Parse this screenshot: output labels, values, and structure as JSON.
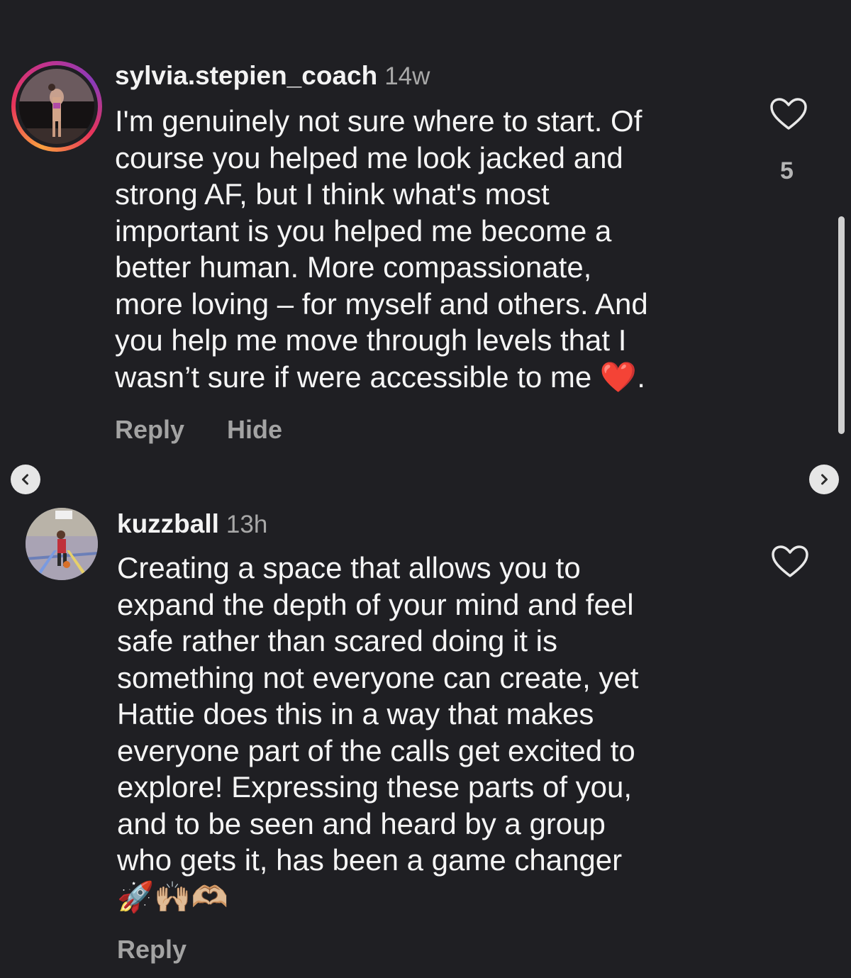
{
  "comments": [
    {
      "username": "sylvia.stepien_coach",
      "time": "14w",
      "lines": [
        "I'm genuinely not sure where to start. Of",
        "course you helped me look jacked and",
        "strong AF, but I think what's most",
        "important is you helped me become a",
        "better human. More compassionate,",
        "more loving – for myself and others. And",
        "you help me move through levels that I",
        "wasn’t sure if were accessible to me ❤️."
      ],
      "like_count": "5",
      "reply_label": "Reply",
      "hide_label": "Hide",
      "has_story_ring": true
    },
    {
      "username": "kuzzball",
      "time": "13h",
      "lines": [
        "Creating a space that allows you to",
        "expand the depth of your mind and feel",
        "safe rather than scared doing it is",
        "something not everyone can create, yet",
        "Hattie does this in a way that makes",
        "everyone part of the calls get excited to",
        "explore! Expressing these parts of you,",
        "and to be seen and heard by a group",
        "who gets it, has been a game changer",
        "🚀🙌🏼🫶🏼"
      ],
      "reply_label": "Reply",
      "has_story_ring": false
    }
  ],
  "nav": {
    "prev_icon": "chevron-left-icon",
    "next_icon": "chevron-right-icon"
  },
  "colors": {
    "background": "#1f1f23",
    "text": "#f5f5f5",
    "muted": "#a8a8a8"
  }
}
